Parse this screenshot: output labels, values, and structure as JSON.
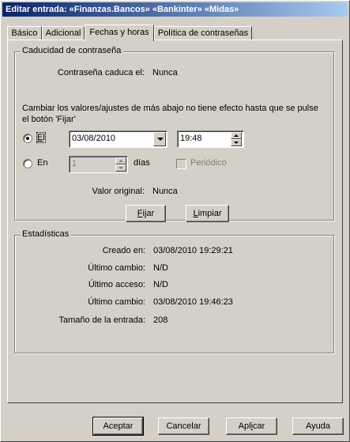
{
  "window": {
    "title": "Editar entrada:   «Finanzas.Bancos» «Bankinter» «Midas»"
  },
  "tabs": [
    {
      "label": "Básico"
    },
    {
      "label": "Adicional"
    },
    {
      "label": "Fechas y horas"
    },
    {
      "label": "Política de contraseñas"
    }
  ],
  "expiry": {
    "group_title": "Caducidad de contraseña",
    "expires_label": "Contraseña caduca el:",
    "expires_value": "Nunca",
    "notice": "Cambiar los valores/ajustes de más abajo no tiene efecto hasta que se pulse el botón 'Fijar'",
    "radio_on_label_u": "E",
    "radio_on_label_rest": "l",
    "radio_in_label": "En",
    "date_value": "03/08/2010",
    "time_value": "19:48",
    "days_value": "1",
    "days_label": "días",
    "periodic_label": "Periódico",
    "original_label": "Valor original:",
    "original_value": "Nunca",
    "set_button_u": "F",
    "set_button_rest": "ijar",
    "clear_button_u": "L",
    "clear_button_rest": "impiar"
  },
  "stats": {
    "group_title": "Estadísticas",
    "rows": [
      {
        "label": "Creado en:",
        "value": "03/08/2010 19:29:21"
      },
      {
        "label": "Último cambio:",
        "value": "N/D"
      },
      {
        "label": "Último acceso:",
        "value": "N/D"
      },
      {
        "label": "Último cambio:",
        "value": "03/08/2010 19:46:23"
      },
      {
        "label": "Tamaño de la entrada:",
        "value": "208"
      }
    ]
  },
  "footer": {
    "accept": "Aceptar",
    "cancel": "Cancelar",
    "apply_pre": "Apl",
    "apply_u": "i",
    "apply_post": "car",
    "help": "Ayuda"
  }
}
